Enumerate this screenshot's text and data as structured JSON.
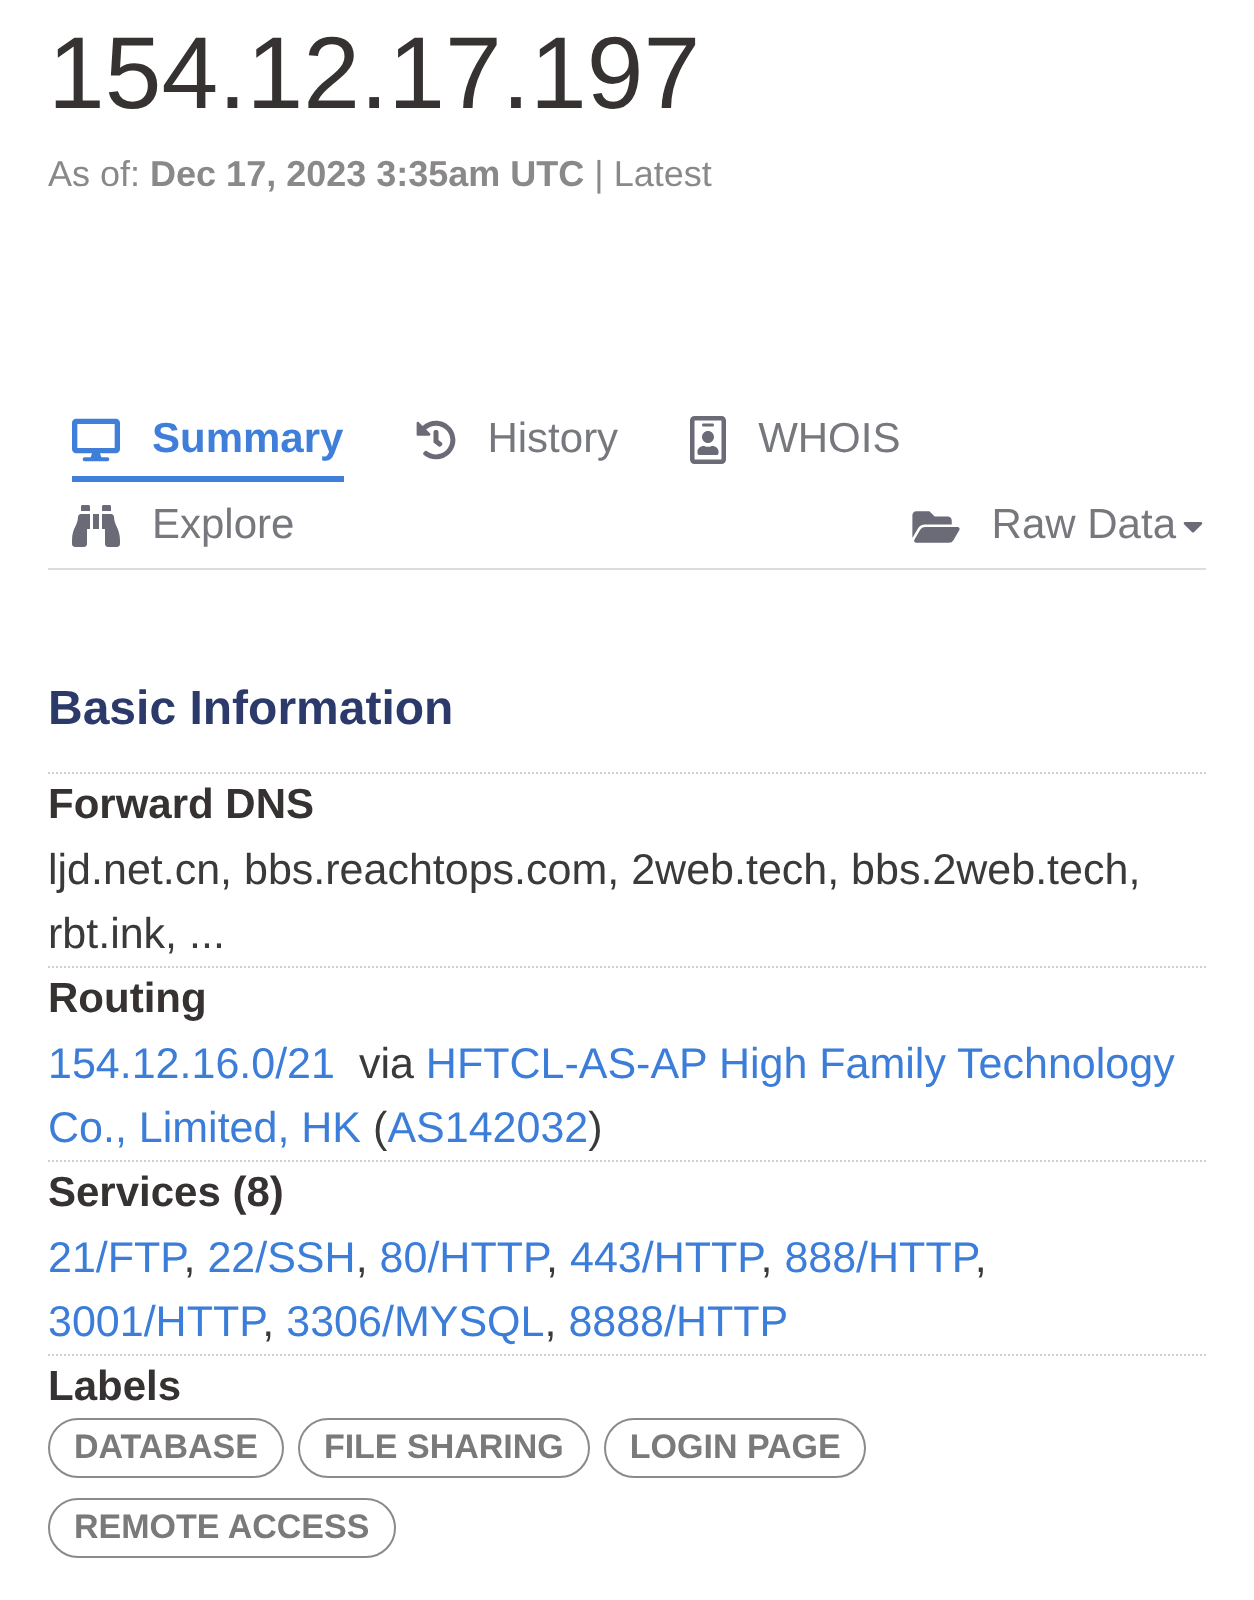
{
  "header": {
    "title": "154.12.17.197",
    "as_of": "As of: **Dec 17, 2023 3:35am UTC** | Latest"
  },
  "tabs": [
    {
      "label": "Summary",
      "selected": true
    },
    {
      "label": "History",
      "selected": false
    },
    {
      "label": "WHOIS",
      "selected": false
    },
    {
      "label": "Explore",
      "selected": false
    }
  ],
  "raw_data_menu": {
    "label": "Raw Data"
  },
  "basic_information": {
    "heading": "Basic Information",
    "fields": [
      {
        "kind": "text",
        "label": "Forward DNS",
        "value": "ljd.net.cn, bbs.reachtops.com, 2web.tech, bbs.2web.tech, rbt.ink, ..."
      },
      {
        "kind": "routing",
        "label": "Routing",
        "network": "154.12.16.0/21",
        "via": "via",
        "organization": [
          "HFTCL-AS-AP High Family Technology",
          "Co., Limited, HK"
        ],
        "asn_open": "(",
        "asn": "AS142032",
        "asn_close": ")"
      },
      {
        "kind": "links",
        "label": "Services (8)",
        "separator": ",",
        "items": [
          "21/FTP",
          "22/SSH",
          "80/HTTP",
          "443/HTTP",
          "888/HTTP",
          "3001/HTTP",
          "3306/MYSQL",
          "8888/HTTP"
        ]
      },
      {
        "kind": "tags",
        "label": "Labels",
        "items": [
          "DATABASE",
          "FILE SHARING",
          "LOGIN PAGE",
          "REMOTE ACCESS"
        ]
      }
    ]
  }
}
